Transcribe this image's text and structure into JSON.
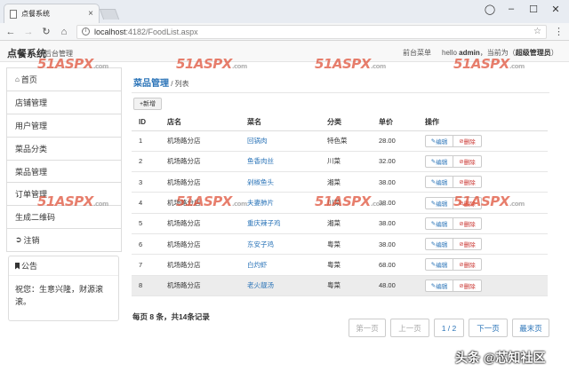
{
  "browser": {
    "tab_title": "点餐系统",
    "url_host": "localhost",
    "url_rest": ":4182/FoodList.aspx"
  },
  "header": {
    "brand": "点餐系统",
    "brand_sub": "后台管理",
    "front_menu": "前台菜单",
    "greeting": "hello",
    "username": "admin",
    "role_prefix": "，当前为（",
    "role": "超级管理员",
    "role_suffix": "）"
  },
  "sidebar": {
    "items": [
      {
        "label": "首页"
      },
      {
        "label": "店铺管理"
      },
      {
        "label": "用户管理"
      },
      {
        "label": "菜品分类"
      },
      {
        "label": "菜品管理"
      },
      {
        "label": "订单管理"
      },
      {
        "label": "生成二维码"
      },
      {
        "label": "注销"
      }
    ],
    "notice_title": "公告",
    "notice_body": "祝您：生意兴隆，财源滚滚。"
  },
  "main": {
    "crumb_current": "菜品管理",
    "crumb_sep": " / ",
    "crumb_sub": "列表",
    "add_button": "新增",
    "columns": [
      "ID",
      "店名",
      "菜名",
      "分类",
      "单价",
      "操作"
    ],
    "rows": [
      {
        "id": "1",
        "shop": "机场路分店",
        "name": "回锅肉",
        "category": "特色菜",
        "price": "28.00"
      },
      {
        "id": "2",
        "shop": "机场路分店",
        "name": "鱼香肉丝",
        "category": "川菜",
        "price": "32.00"
      },
      {
        "id": "3",
        "shop": "机场路分店",
        "name": "剁椒鱼头",
        "category": "湘菜",
        "price": "38.00"
      },
      {
        "id": "4",
        "shop": "机场路分店",
        "name": "夫妻肺片",
        "category": "川菜",
        "price": "38.00"
      },
      {
        "id": "5",
        "shop": "机场路分店",
        "name": "重庆辣子鸡",
        "category": "湘菜",
        "price": "38.00"
      },
      {
        "id": "6",
        "shop": "机场路分店",
        "name": "东安子鸡",
        "category": "粤菜",
        "price": "38.00"
      },
      {
        "id": "7",
        "shop": "机场路分店",
        "name": "白灼虾",
        "category": "粤菜",
        "price": "68.00"
      },
      {
        "id": "8",
        "shop": "机场路分店",
        "name": "老火靓汤",
        "category": "粤菜",
        "price": "48.00"
      }
    ],
    "edit_label": "编辑",
    "delete_label": "删除",
    "page_info": "每页 8 条，共14条记录",
    "pager": {
      "first": "第一页",
      "prev": "上一页",
      "current": "1 / 2",
      "next": "下一页",
      "last": "最末页"
    }
  },
  "watermark": {
    "text": "51ASPX",
    "suffix": ".com"
  },
  "source_mark": "头条 @芯知社区",
  "colors": {
    "link": "#2b74b8",
    "danger": "#c9302c",
    "watermark": "#e0533b"
  }
}
